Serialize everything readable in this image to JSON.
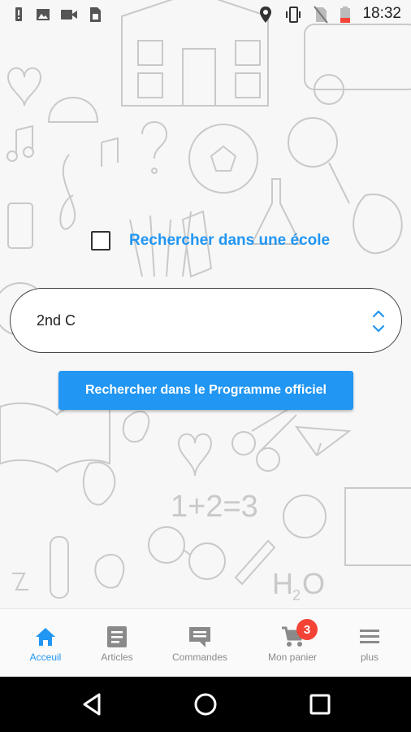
{
  "status_bar": {
    "time": "18:32",
    "left_icons": [
      "alert-icon",
      "image-icon",
      "video-icon",
      "sim-icon"
    ],
    "right_icons": [
      "location-icon",
      "vibrate-icon",
      "no-sim-icon",
      "battery-icon"
    ]
  },
  "search": {
    "checkbox_label": "Rechercher dans une école",
    "checkbox_checked": false,
    "select_value": "2nd C",
    "button_label": "Rechercher dans le Programme officiel"
  },
  "bottom_nav": {
    "items": [
      {
        "label": "Acceuil",
        "icon": "home-icon",
        "active": true
      },
      {
        "label": "Articles",
        "icon": "article-icon",
        "active": false
      },
      {
        "label": "Commandes",
        "icon": "comment-icon",
        "active": false
      },
      {
        "label": "Mon panier",
        "icon": "cart-icon",
        "active": false,
        "badge": "3"
      },
      {
        "label": "plus",
        "icon": "menu-icon",
        "active": false
      }
    ]
  },
  "system_nav": [
    "back-icon",
    "home-circle-icon",
    "recents-icon"
  ],
  "colors": {
    "accent": "#2196f3",
    "badge": "#f44336",
    "inactive": "#8a8a8a"
  }
}
